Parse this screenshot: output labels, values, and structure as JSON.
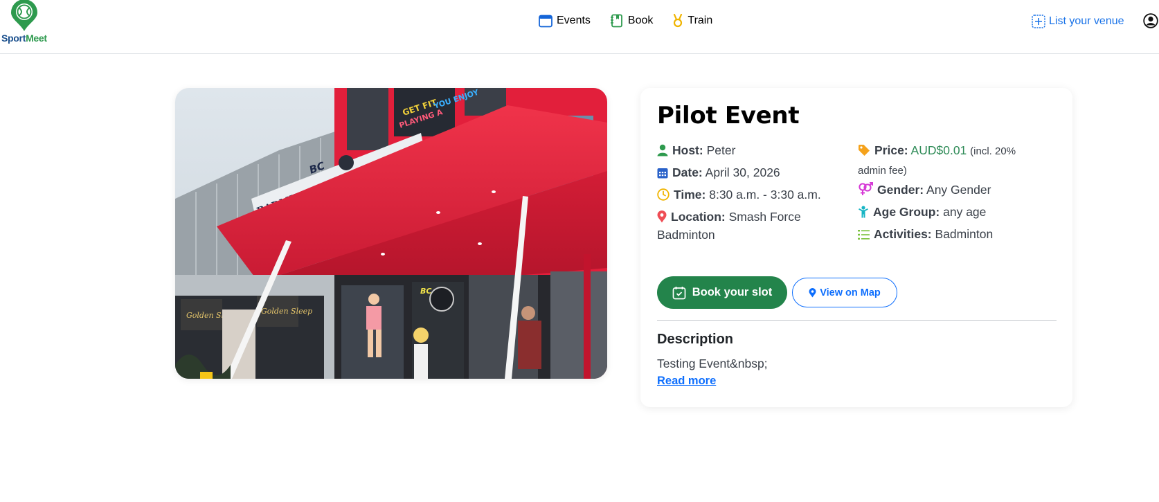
{
  "brand": {
    "part1": "Sport",
    "part2": "Meet",
    "pin_color": "#2e9a4e"
  },
  "nav": {
    "events": "Events",
    "book": "Book",
    "train": "Train",
    "list_venue": "List your venue"
  },
  "event": {
    "title": "Pilot Event",
    "host_label": "Host:",
    "host": "Peter",
    "date_label": "Date:",
    "date": "April 30, 2026",
    "time_label": "Time:",
    "time": "8:30 a.m. - 3:30 a.m.",
    "location_label": "Location:",
    "location": "Smash Force Badminton",
    "price_label": "Price:",
    "price": "AUD$0.01",
    "price_note": "(incl. 20% admin fee)",
    "gender_label": "Gender:",
    "gender": "Any Gender",
    "age_label": "Age Group:",
    "age": "any age",
    "activities_label": "Activities:",
    "activities": "Badminton"
  },
  "actions": {
    "book": "Book your slot",
    "map": "View on Map"
  },
  "description": {
    "heading": "Description",
    "text": "Testing Event&nbsp;",
    "read_more": "Read more"
  },
  "hero_signage": {
    "banner": "BADMINTON AND TABLE TENNIS CONNECT",
    "logo_short": "BC",
    "poster": "GET FIT PLAYING A GAME YOU ENJOY",
    "shop": "Golden Sleep"
  },
  "colors": {
    "primary_green": "#23844b",
    "link_blue": "#0d6efd",
    "price_green": "#2e8b57",
    "canopy_red": "#e8283e"
  }
}
